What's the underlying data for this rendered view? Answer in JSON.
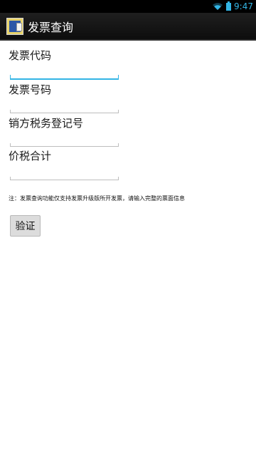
{
  "status_bar": {
    "time": "9:47",
    "icons": [
      "wifi-icon",
      "battery-icon"
    ],
    "accent": "#33b5e5"
  },
  "app": {
    "title": "发票查询"
  },
  "form": {
    "fields": [
      {
        "label": "发票代码",
        "value": "",
        "focused": true
      },
      {
        "label": "发票号码",
        "value": ""
      },
      {
        "label": "销方税务登记号",
        "value": ""
      },
      {
        "label": "价税合计",
        "value": ""
      }
    ],
    "note": "注：发票查询功能仅支持发票升级版所开发票，请输入完整的票面信息",
    "verify_label": "验证"
  }
}
